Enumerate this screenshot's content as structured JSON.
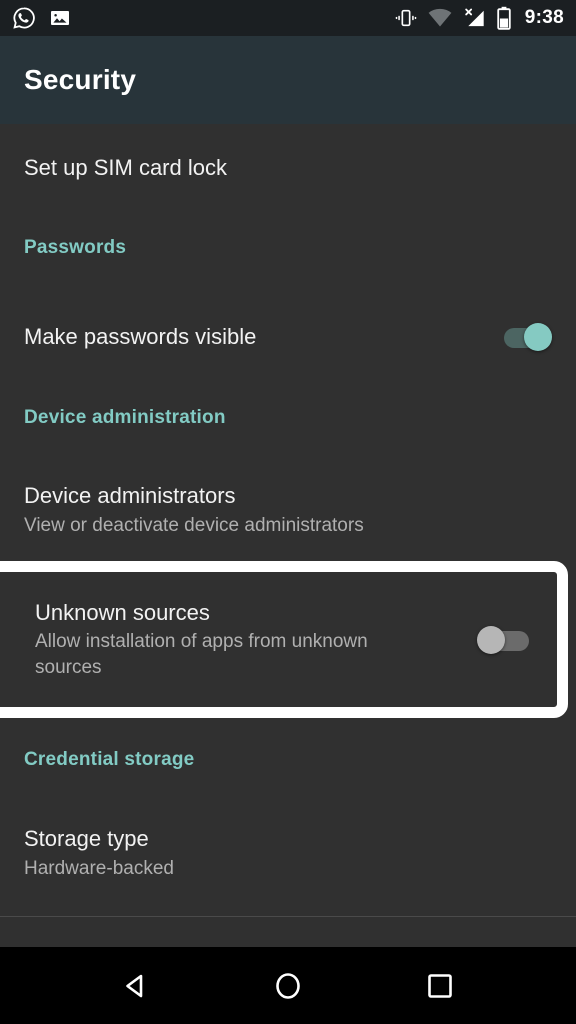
{
  "status_bar": {
    "left_icons": [
      {
        "name": "whatsapp-icon",
        "label": "WhatsApp"
      },
      {
        "name": "image-icon",
        "label": "Photo"
      }
    ],
    "right_icons": [
      {
        "name": "vibrate-icon",
        "label": "Vibrate"
      },
      {
        "name": "wifi-icon",
        "label": "Wi-Fi"
      },
      {
        "name": "no-sim-signal-icon",
        "label": "No signal"
      },
      {
        "name": "battery-icon",
        "label": "Battery"
      }
    ],
    "clock": "9:38"
  },
  "header": {
    "title": "Security"
  },
  "colors": {
    "accent_teal": "#82cbc4",
    "header_bg": "#28343a",
    "page_bg": "#303030",
    "statusbar_bg": "#1b1f22",
    "highlight_border": "#ffffff",
    "switch_on_thumb": "#85cac2",
    "switch_off_thumb": "#b6b6b6"
  },
  "list": {
    "sim_lock": {
      "title": "Set up SIM card lock"
    },
    "passwords_header": "Passwords",
    "make_passwords_visible": {
      "title": "Make passwords visible",
      "switch_state": "on"
    },
    "device_admin_header": "Device administration",
    "device_administrators": {
      "title": "Device administrators",
      "subtitle": "View or deactivate device administrators"
    },
    "unknown_sources": {
      "title": "Unknown sources",
      "subtitle": "Allow installation of apps from unknown sources",
      "switch_state": "off",
      "highlighted": "true"
    },
    "credential_storage_header": "Credential storage",
    "storage_type": {
      "title": "Storage type",
      "subtitle": "Hardware-backed"
    }
  },
  "nav_bar": {
    "back": "Back",
    "home": "Home",
    "recents": "Recent apps"
  }
}
